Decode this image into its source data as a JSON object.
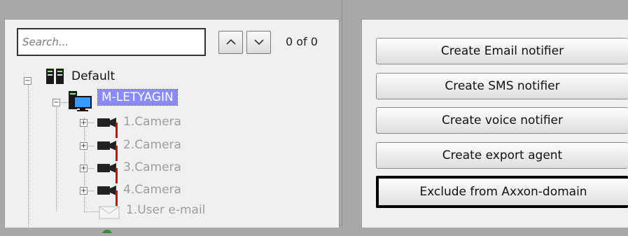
{
  "search": {
    "placeholder": "Search...",
    "value": "",
    "count_text": "0 of 0"
  },
  "tree": {
    "root": {
      "label": "Default"
    },
    "server": {
      "label": "M-LETYAGIN"
    },
    "children": [
      {
        "label": "1.Camera",
        "icon": "camera-icon"
      },
      {
        "label": "2.Camera",
        "icon": "camera-icon"
      },
      {
        "label": "3.Camera",
        "icon": "camera-icon"
      },
      {
        "label": "4.Camera",
        "icon": "camera-icon"
      },
      {
        "label": "1.User e-mail",
        "icon": "email-icon"
      }
    ]
  },
  "actions": {
    "create_email": "Create Email notifier",
    "create_sms": "Create SMS notifier",
    "create_voice": "Create voice notifier",
    "create_export": "Create export agent",
    "exclude_domain": "Exclude from Axxon-domain"
  },
  "colors": {
    "selected": "#8a8aff",
    "disabled_text": "#9d9d9d",
    "marker": "#e00000"
  }
}
